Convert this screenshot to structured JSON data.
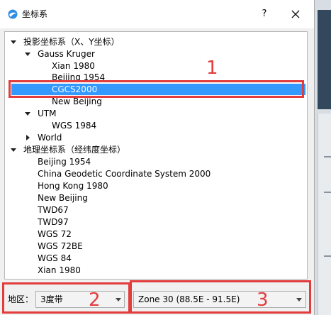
{
  "window": {
    "title": "坐标系",
    "help_label": "?"
  },
  "tree": {
    "projected": "投影坐标系（X、Y坐标）",
    "gauss": "Gauss Kruger",
    "gauss_items": [
      "Xian 1980",
      "Beijing 1954",
      "CGCS2000",
      "New Beijing"
    ],
    "utm": "UTM",
    "utm_items": [
      "WGS 1984"
    ],
    "world": "World",
    "geographic": "地理坐标系（经纬度坐标）",
    "geo_items": [
      "Beijing 1954",
      "China Geodetic Coordinate System 2000",
      "Hong Kong 1980",
      "New Beijing",
      "TWD67",
      "TWD97",
      "WGS 72",
      "WGS 72BE",
      "WGS 84",
      "Xian 1980"
    ],
    "selected": "CGCS2000"
  },
  "bottom": {
    "region_label": "地区：",
    "band_value": "3度带",
    "zone_value": "Zone 30 (88.5E - 91.5E)"
  },
  "annotations": {
    "n1": "1",
    "n2": "2",
    "n3": "3"
  },
  "colors": {
    "selection": "#3399ff",
    "annotation": "#e23c3c"
  }
}
